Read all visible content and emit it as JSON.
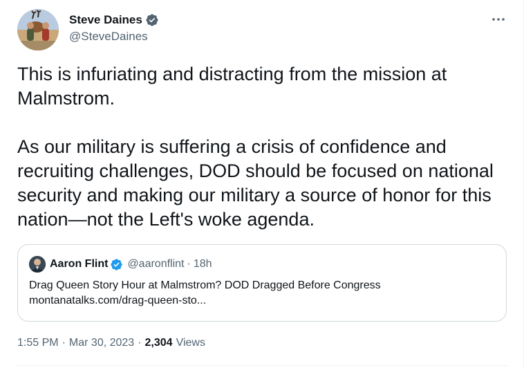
{
  "author": {
    "display_name": "Steve Daines",
    "handle": "@SteveDaines",
    "avatar_icon": "profile-photo",
    "verified_icon": "verified-badge-icon"
  },
  "more_icon": "more-horizontal-icon",
  "tweet": {
    "paragraphs": [
      "This is infuriating and distracting from the mission at Malmstrom.",
      "As our military is suffering a crisis of confidence and recruiting challenges, DOD should be focused on national security and making our military a source of honor for this nation—not the Left's woke agenda."
    ]
  },
  "quote": {
    "display_name": "Aaron Flint",
    "handle": "@aaronflint",
    "separator": "·",
    "age": "18h",
    "text": "Drag Queen Story Hour at Malmstrom? DOD Dragged Before Congress",
    "link": "montanatalks.com/drag-queen-sto..."
  },
  "meta": {
    "time": "1:55 PM",
    "separator": "·",
    "date": "Mar 30, 2023",
    "views_count": "2,304",
    "views_label": "Views"
  },
  "colors": {
    "verified": "#1d9bf0",
    "secondary_text": "#536471",
    "primary_text": "#0f1419",
    "border": "#cfd9de"
  }
}
